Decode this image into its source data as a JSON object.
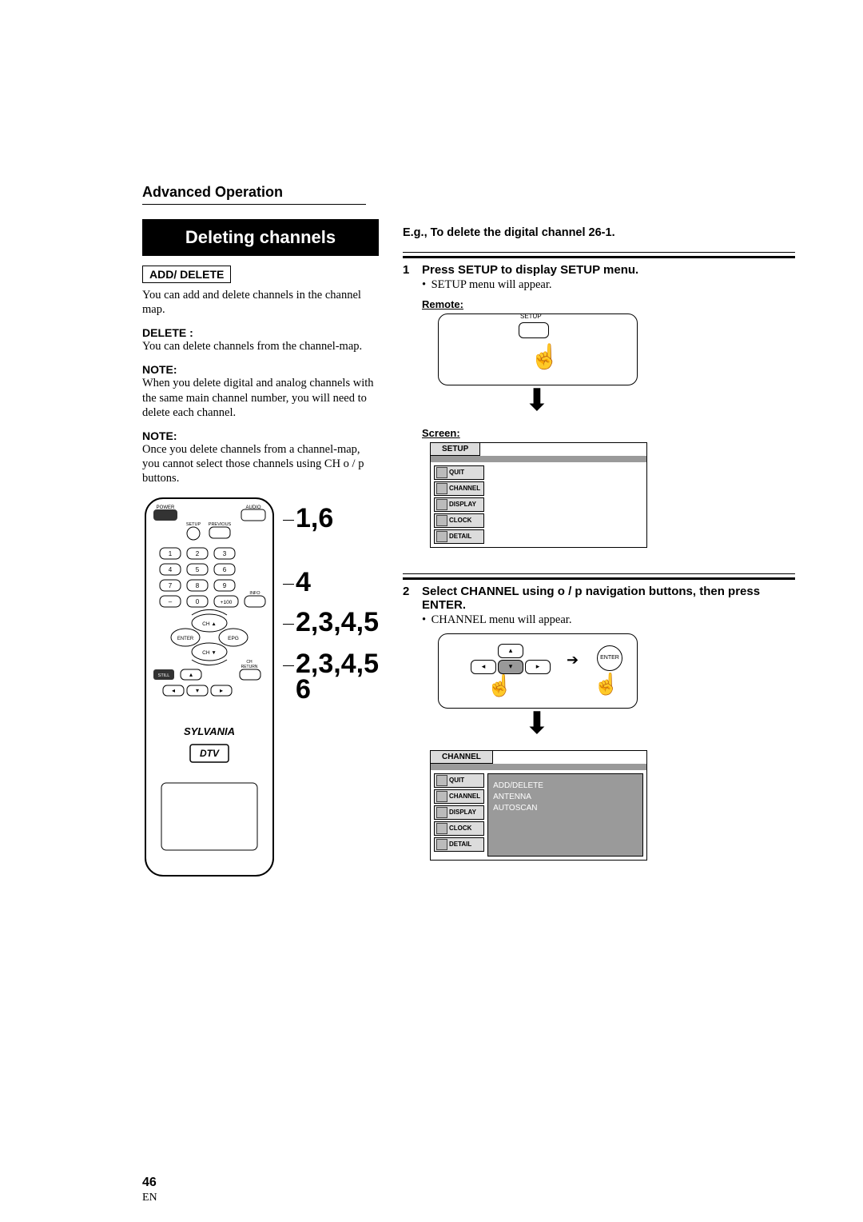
{
  "page": {
    "section_title": "Advanced Operation",
    "main_title": "Deleting channels",
    "add_delete_label": "ADD/ DELETE",
    "add_delete_desc": "You can add and delete channels in the channel map.",
    "delete_label": "DELETE :",
    "delete_desc": "You can delete channels from the channel-map.",
    "note1_label": "NOTE:",
    "note1_desc": "When you delete digital and analog channels with the same main channel number, you will need to delete each channel.",
    "note2_label": "NOTE:",
    "note2_desc": "Once you delete channels from a channel-map, you cannot select those channels using CH o / p buttons.",
    "callouts": [
      "1,6",
      "4",
      "2,3,4,5",
      "2,3,4,5",
      "6"
    ],
    "remote": {
      "power": "POWER",
      "audio": "AUDIO",
      "setup": "SETUP",
      "previous": "PREVIOUS",
      "numbers": [
        "1",
        "2",
        "3",
        "4",
        "5",
        "6",
        "7",
        "8",
        "9",
        "–",
        "0",
        "+100"
      ],
      "info": "INFO",
      "ch_up": "CH ▲",
      "ch_down": "CH ▼",
      "enter": "ENTER",
      "epg": "EPG",
      "still": "STILL",
      "ch_return": "CH RETURN",
      "brand": "SYLVANIA",
      "dtv": "DTV"
    },
    "eg_text": "E.g., To delete the digital channel 26-1.",
    "steps": [
      {
        "num": "1",
        "title": "Press SETUP to display SETUP menu.",
        "desc": "SETUP menu will appear.",
        "remote_label": "Remote:",
        "remote_button": "SETUP",
        "screen_label": "Screen:",
        "menu_title": "SETUP",
        "menu_items": [
          "QUIT",
          "CHANNEL",
          "DISPLAY",
          "CLOCK",
          "DETAIL"
        ]
      },
      {
        "num": "2",
        "title": "Select CHANNEL using o / p navigation buttons, then press ENTER.",
        "desc": "CHANNEL menu will appear.",
        "enter_label": "ENTER",
        "menu_title": "CHANNEL",
        "menu_items": [
          "QUIT",
          "CHANNEL",
          "DISPLAY",
          "CLOCK",
          "DETAIL"
        ],
        "menu_detail": [
          "ADD/DELETE",
          "ANTENNA",
          "AUTOSCAN"
        ]
      }
    ],
    "page_number": "46",
    "page_lang": "EN"
  }
}
